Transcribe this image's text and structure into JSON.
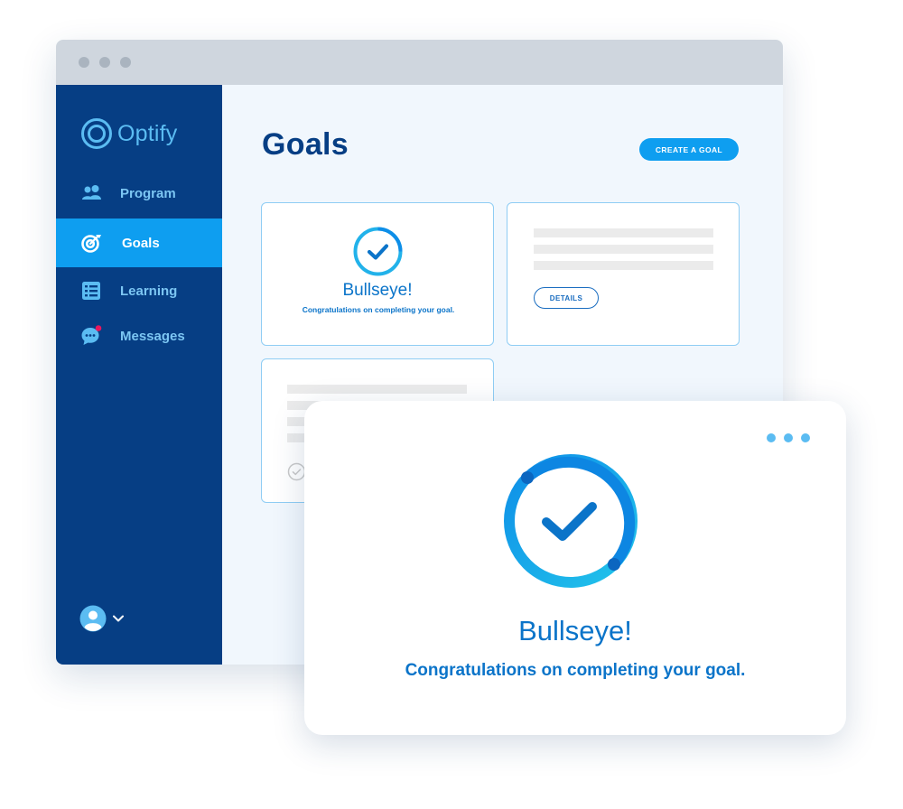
{
  "app": {
    "name": "Optify",
    "colors": {
      "sidebar": "#063e84",
      "accent": "#0e9ef0",
      "text_accent": "#0b74c9",
      "notification": "#e8175d"
    }
  },
  "sidebar": {
    "items": [
      {
        "label": "Program",
        "icon": "people-icon",
        "active": false
      },
      {
        "label": "Goals",
        "icon": "target-icon",
        "active": true
      },
      {
        "label": "Learning",
        "icon": "list-icon",
        "active": false
      },
      {
        "label": "Messages",
        "icon": "chat-bubble-icon",
        "active": false,
        "has_notification": true
      }
    ],
    "user": {
      "icon": "user-avatar-icon",
      "menu_icon": "chevron-down-icon"
    }
  },
  "main": {
    "title": "Goals",
    "create_button": "CREATE A GOAL",
    "cards": [
      {
        "status_icon": "check-circle-icon",
        "title": "Bullseye!",
        "description": "Congratulations on completing your goal."
      },
      {
        "button": "DETAILS"
      },
      {
        "status_icon": "check-circle-icon"
      }
    ]
  },
  "popup": {
    "icon": "check-circle-icon",
    "title": "Bullseye!",
    "message": "Congratulations on completing your goal.",
    "more_icon": "more-dots-icon"
  }
}
